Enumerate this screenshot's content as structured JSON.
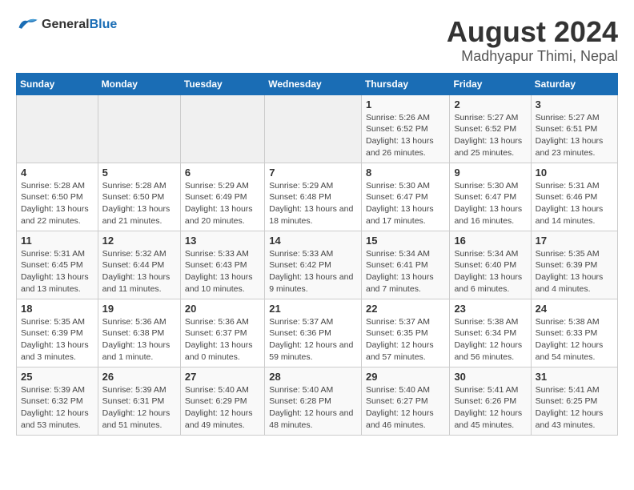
{
  "header": {
    "logo_general": "General",
    "logo_blue": "Blue",
    "title": "August 2024",
    "subtitle": "Madhyapur Thimi, Nepal"
  },
  "calendar": {
    "days_of_week": [
      "Sunday",
      "Monday",
      "Tuesday",
      "Wednesday",
      "Thursday",
      "Friday",
      "Saturday"
    ],
    "weeks": [
      [
        {
          "day": "",
          "info": ""
        },
        {
          "day": "",
          "info": ""
        },
        {
          "day": "",
          "info": ""
        },
        {
          "day": "",
          "info": ""
        },
        {
          "day": "1",
          "info": "Sunrise: 5:26 AM\nSunset: 6:52 PM\nDaylight: 13 hours\nand 26 minutes."
        },
        {
          "day": "2",
          "info": "Sunrise: 5:27 AM\nSunset: 6:52 PM\nDaylight: 13 hours\nand 25 minutes."
        },
        {
          "day": "3",
          "info": "Sunrise: 5:27 AM\nSunset: 6:51 PM\nDaylight: 13 hours\nand 23 minutes."
        }
      ],
      [
        {
          "day": "4",
          "info": "Sunrise: 5:28 AM\nSunset: 6:50 PM\nDaylight: 13 hours\nand 22 minutes."
        },
        {
          "day": "5",
          "info": "Sunrise: 5:28 AM\nSunset: 6:50 PM\nDaylight: 13 hours\nand 21 minutes."
        },
        {
          "day": "6",
          "info": "Sunrise: 5:29 AM\nSunset: 6:49 PM\nDaylight: 13 hours\nand 20 minutes."
        },
        {
          "day": "7",
          "info": "Sunrise: 5:29 AM\nSunset: 6:48 PM\nDaylight: 13 hours\nand 18 minutes."
        },
        {
          "day": "8",
          "info": "Sunrise: 5:30 AM\nSunset: 6:47 PM\nDaylight: 13 hours\nand 17 minutes."
        },
        {
          "day": "9",
          "info": "Sunrise: 5:30 AM\nSunset: 6:47 PM\nDaylight: 13 hours\nand 16 minutes."
        },
        {
          "day": "10",
          "info": "Sunrise: 5:31 AM\nSunset: 6:46 PM\nDaylight: 13 hours\nand 14 minutes."
        }
      ],
      [
        {
          "day": "11",
          "info": "Sunrise: 5:31 AM\nSunset: 6:45 PM\nDaylight: 13 hours\nand 13 minutes."
        },
        {
          "day": "12",
          "info": "Sunrise: 5:32 AM\nSunset: 6:44 PM\nDaylight: 13 hours\nand 11 minutes."
        },
        {
          "day": "13",
          "info": "Sunrise: 5:33 AM\nSunset: 6:43 PM\nDaylight: 13 hours\nand 10 minutes."
        },
        {
          "day": "14",
          "info": "Sunrise: 5:33 AM\nSunset: 6:42 PM\nDaylight: 13 hours\nand 9 minutes."
        },
        {
          "day": "15",
          "info": "Sunrise: 5:34 AM\nSunset: 6:41 PM\nDaylight: 13 hours\nand 7 minutes."
        },
        {
          "day": "16",
          "info": "Sunrise: 5:34 AM\nSunset: 6:40 PM\nDaylight: 13 hours\nand 6 minutes."
        },
        {
          "day": "17",
          "info": "Sunrise: 5:35 AM\nSunset: 6:39 PM\nDaylight: 13 hours\nand 4 minutes."
        }
      ],
      [
        {
          "day": "18",
          "info": "Sunrise: 5:35 AM\nSunset: 6:39 PM\nDaylight: 13 hours\nand 3 minutes."
        },
        {
          "day": "19",
          "info": "Sunrise: 5:36 AM\nSunset: 6:38 PM\nDaylight: 13 hours\nand 1 minute."
        },
        {
          "day": "20",
          "info": "Sunrise: 5:36 AM\nSunset: 6:37 PM\nDaylight: 13 hours\nand 0 minutes."
        },
        {
          "day": "21",
          "info": "Sunrise: 5:37 AM\nSunset: 6:36 PM\nDaylight: 12 hours\nand 59 minutes."
        },
        {
          "day": "22",
          "info": "Sunrise: 5:37 AM\nSunset: 6:35 PM\nDaylight: 12 hours\nand 57 minutes."
        },
        {
          "day": "23",
          "info": "Sunrise: 5:38 AM\nSunset: 6:34 PM\nDaylight: 12 hours\nand 56 minutes."
        },
        {
          "day": "24",
          "info": "Sunrise: 5:38 AM\nSunset: 6:33 PM\nDaylight: 12 hours\nand 54 minutes."
        }
      ],
      [
        {
          "day": "25",
          "info": "Sunrise: 5:39 AM\nSunset: 6:32 PM\nDaylight: 12 hours\nand 53 minutes."
        },
        {
          "day": "26",
          "info": "Sunrise: 5:39 AM\nSunset: 6:31 PM\nDaylight: 12 hours\nand 51 minutes."
        },
        {
          "day": "27",
          "info": "Sunrise: 5:40 AM\nSunset: 6:29 PM\nDaylight: 12 hours\nand 49 minutes."
        },
        {
          "day": "28",
          "info": "Sunrise: 5:40 AM\nSunset: 6:28 PM\nDaylight: 12 hours\nand 48 minutes."
        },
        {
          "day": "29",
          "info": "Sunrise: 5:40 AM\nSunset: 6:27 PM\nDaylight: 12 hours\nand 46 minutes."
        },
        {
          "day": "30",
          "info": "Sunrise: 5:41 AM\nSunset: 6:26 PM\nDaylight: 12 hours\nand 45 minutes."
        },
        {
          "day": "31",
          "info": "Sunrise: 5:41 AM\nSunset: 6:25 PM\nDaylight: 12 hours\nand 43 minutes."
        }
      ]
    ]
  }
}
